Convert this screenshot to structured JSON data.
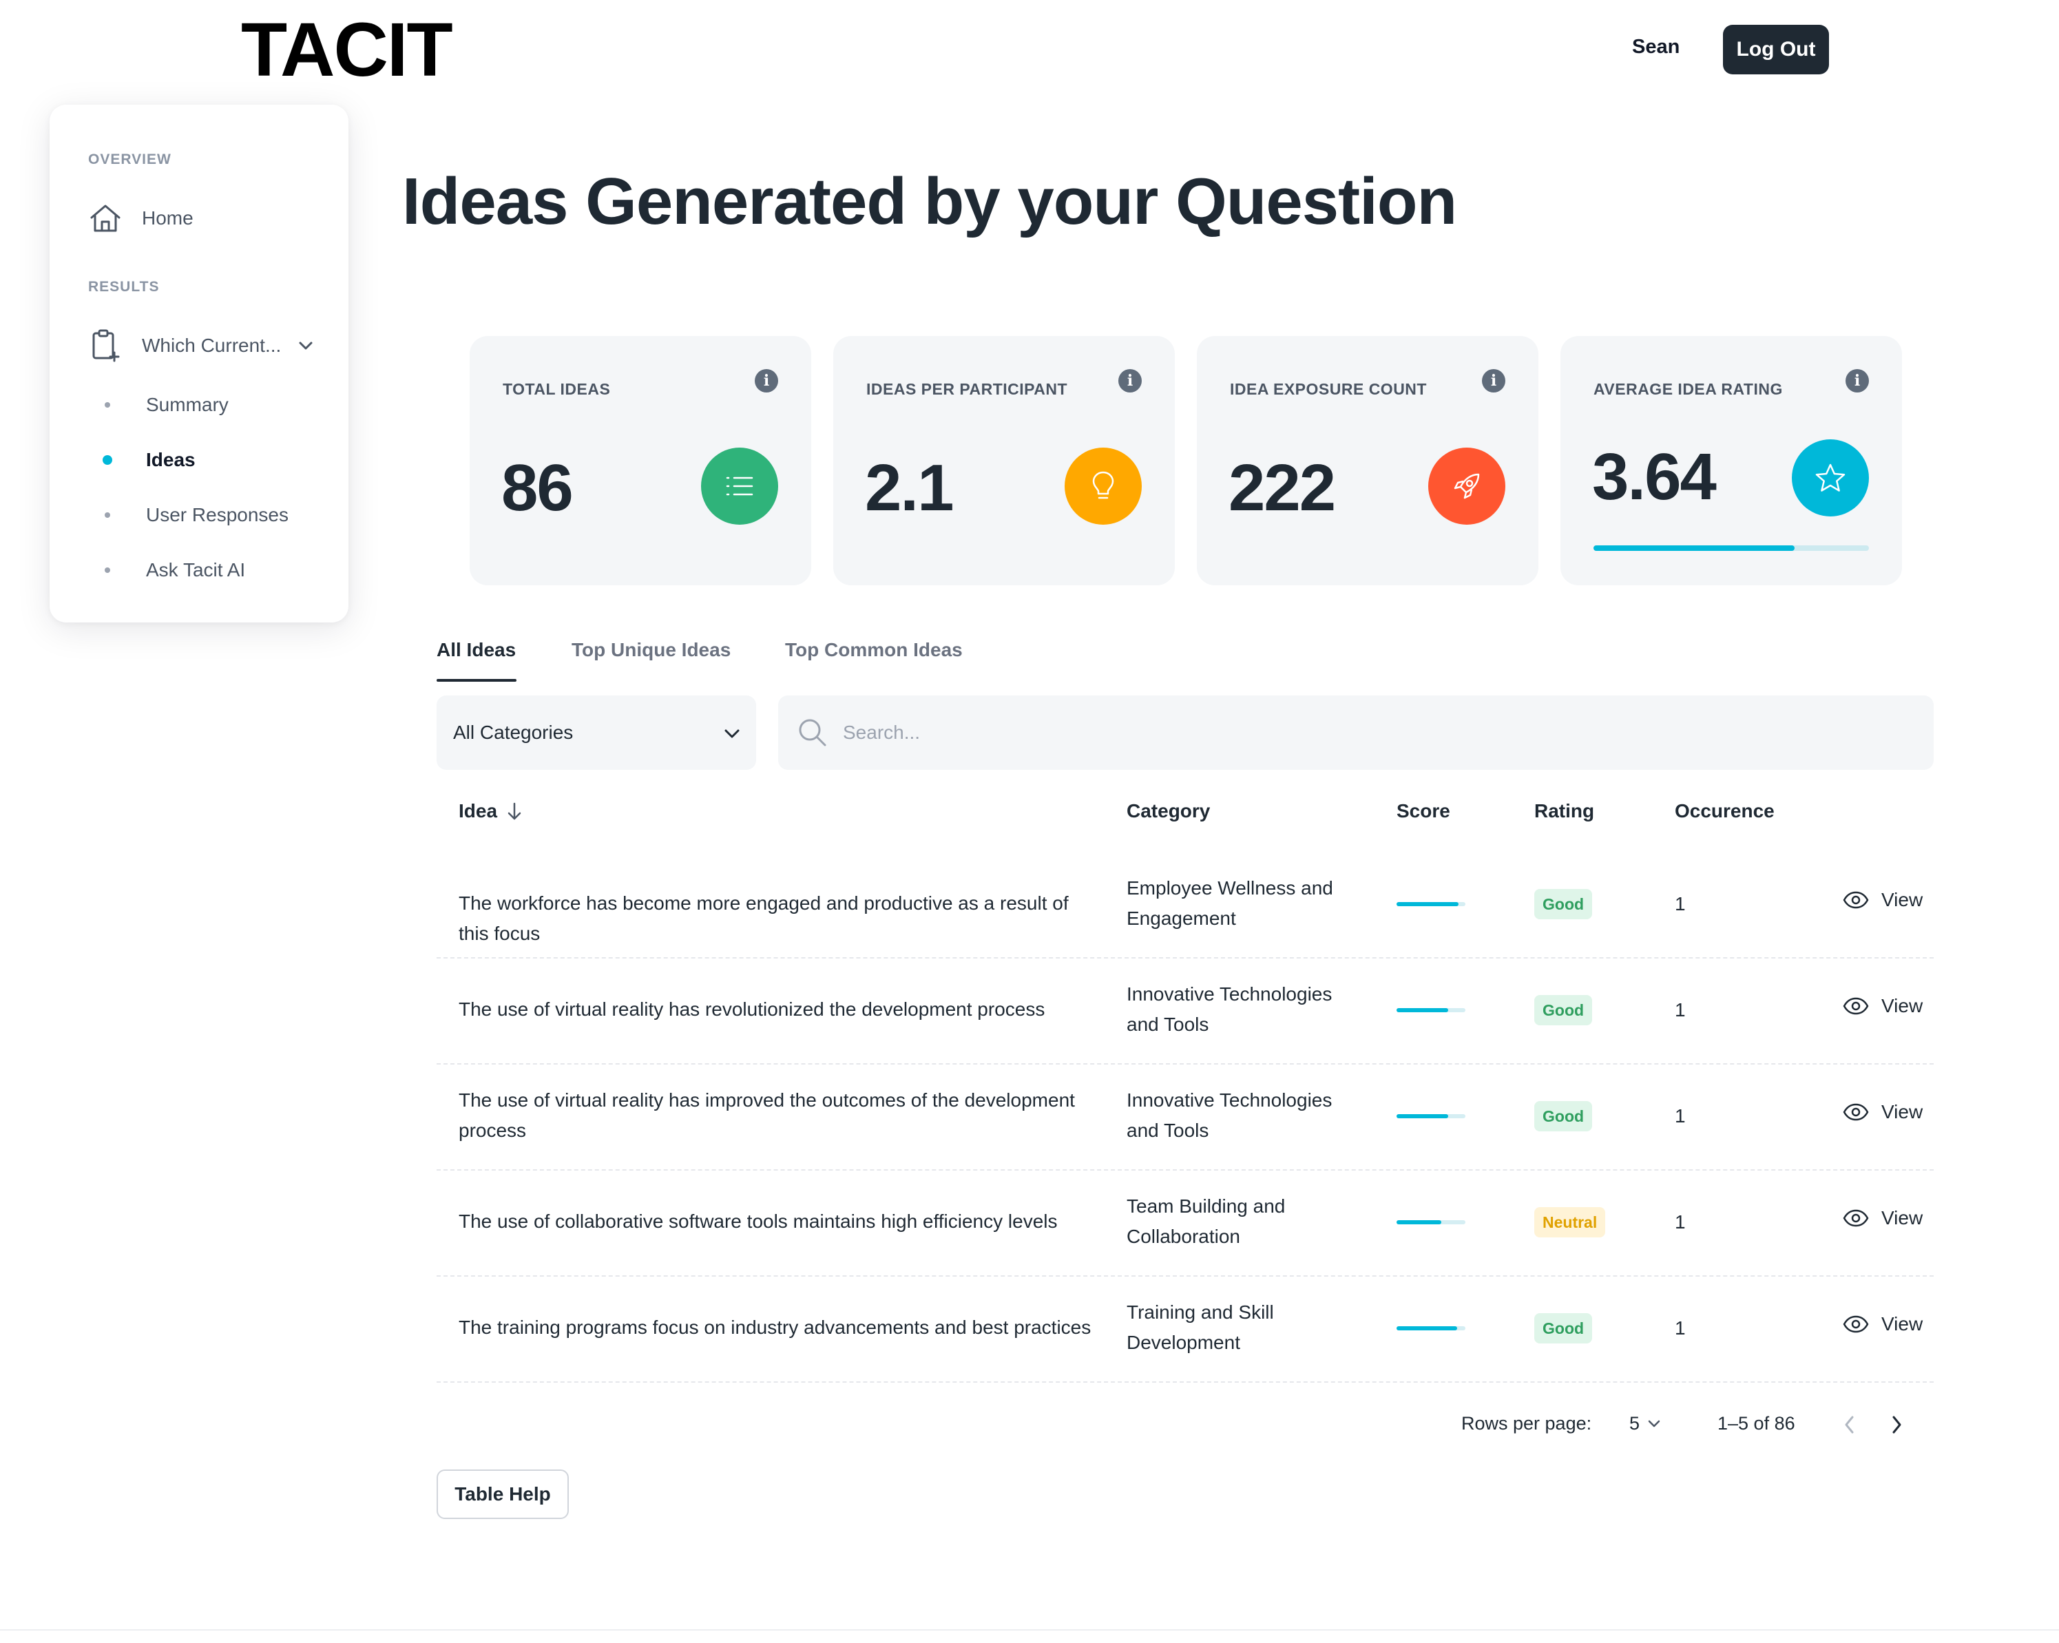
{
  "header": {
    "logo": "TACIT",
    "user": "Sean",
    "logout_label": "Log Out"
  },
  "sidebar": {
    "overview_heading": "OVERVIEW",
    "home_label": "Home",
    "results_heading": "RESULTS",
    "question_label": "Which Current...",
    "sub_items": [
      {
        "label": "Summary",
        "active": false
      },
      {
        "label": "Ideas",
        "active": true
      },
      {
        "label": "User Responses",
        "active": false
      },
      {
        "label": "Ask Tacit AI",
        "active": false
      }
    ]
  },
  "page_title": "Ideas Generated by your Question",
  "stats": [
    {
      "label": "TOTAL IDEAS",
      "value": "86",
      "icon": "list-icon",
      "color": "#2fb37a"
    },
    {
      "label": "IDEAS PER PARTICIPANT",
      "value": "2.1",
      "icon": "lightbulb-icon",
      "color": "#ffa800"
    },
    {
      "label": "IDEA EXPOSURE COUNT",
      "value": "222",
      "icon": "rocket-icon",
      "color": "#ff5630"
    },
    {
      "label": "AVERAGE IDEA RATING",
      "value": "3.64",
      "icon": "star-icon",
      "color": "#00b8d9",
      "progress": 0.73
    }
  ],
  "tabs": [
    "All Ideas",
    "Top Unique Ideas",
    "Top Common Ideas"
  ],
  "filters": {
    "category": "All Categories",
    "search_placeholder": "Search..."
  },
  "table": {
    "columns": [
      "Idea",
      "Category",
      "Score",
      "Rating",
      "Occurence"
    ],
    "view_label": "View",
    "rows": [
      {
        "idea": "The workforce has become more engaged and productive as a result of this focus",
        "category": "Employee Wellness and Engagement",
        "score": 0.9,
        "rating": "Good",
        "occurrence": "1"
      },
      {
        "idea": "The use of virtual reality has revolutionized the development process",
        "category": "Innovative Technologies and Tools",
        "score": 0.75,
        "rating": "Good",
        "occurrence": "1"
      },
      {
        "idea": "The use of virtual reality has improved the outcomes of the development process",
        "category": "Innovative Technologies and Tools",
        "score": 0.75,
        "rating": "Good",
        "occurrence": "1"
      },
      {
        "idea": "The use of collaborative software tools maintains high efficiency levels",
        "category": "Team Building and Collaboration",
        "score": 0.65,
        "rating": "Neutral",
        "occurrence": "1"
      },
      {
        "idea": "The training programs focus on industry advancements and best practices",
        "category": "Training and Skill Development",
        "score": 0.88,
        "rating": "Good",
        "occurrence": "1"
      }
    ]
  },
  "pagination": {
    "rows_per_page_label": "Rows per page:",
    "rows_per_page": "5",
    "range": "1–5 of 86"
  },
  "table_help_label": "Table Help"
}
